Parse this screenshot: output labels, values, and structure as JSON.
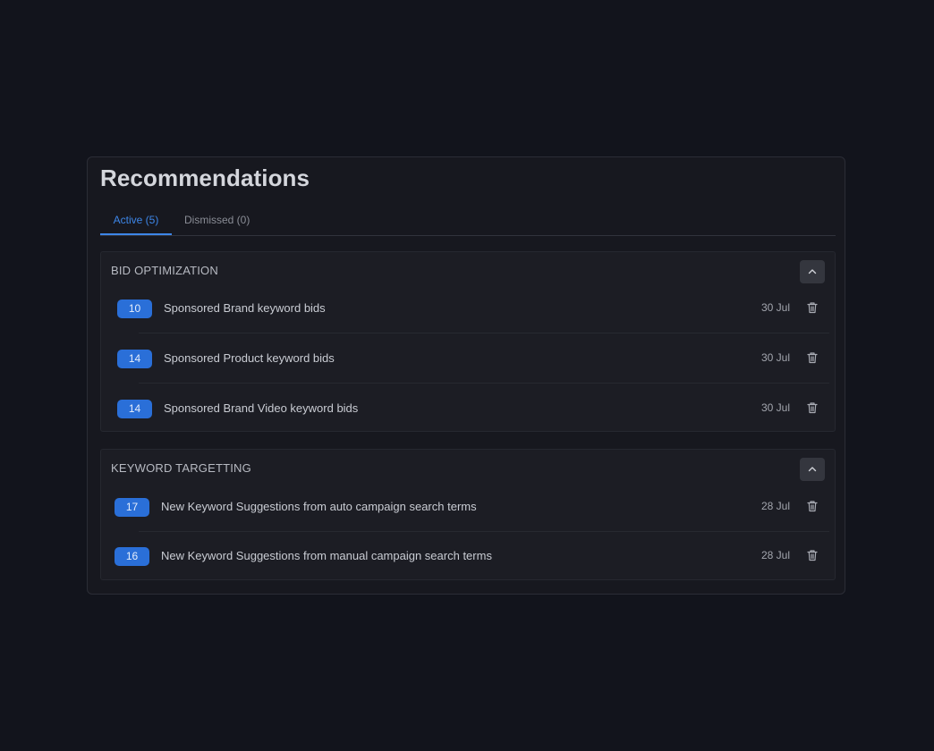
{
  "title": "Recommendations",
  "tabs": [
    {
      "label": "Active (5)",
      "active": true
    },
    {
      "label": "Dismissed (0)",
      "active": false
    }
  ],
  "sections": [
    {
      "title": "BID OPTIMIZATION",
      "rows": [
        {
          "count": "10",
          "label": "Sponsored Brand keyword bids",
          "date": "30 Jul"
        },
        {
          "count": "14",
          "label": "Sponsored Product keyword bids",
          "date": "30 Jul"
        },
        {
          "count": "14",
          "label": "Sponsored Brand Video keyword bids",
          "date": "30 Jul"
        }
      ]
    },
    {
      "title": "KEYWORD TARGETTING",
      "rows": [
        {
          "count": "17",
          "label": "New Keyword Suggestions from auto campaign search terms",
          "date": "28 Jul"
        },
        {
          "count": "16",
          "label": "New Keyword Suggestions from manual campaign search terms",
          "date": "28 Jul"
        }
      ]
    }
  ],
  "icons": {
    "collapse": "chevron-up-icon",
    "delete": "trash-icon"
  },
  "colors": {
    "accent": "#3d86e8",
    "badge": "#2a6fd8",
    "background": "#12141c",
    "panel": "#17181f"
  }
}
